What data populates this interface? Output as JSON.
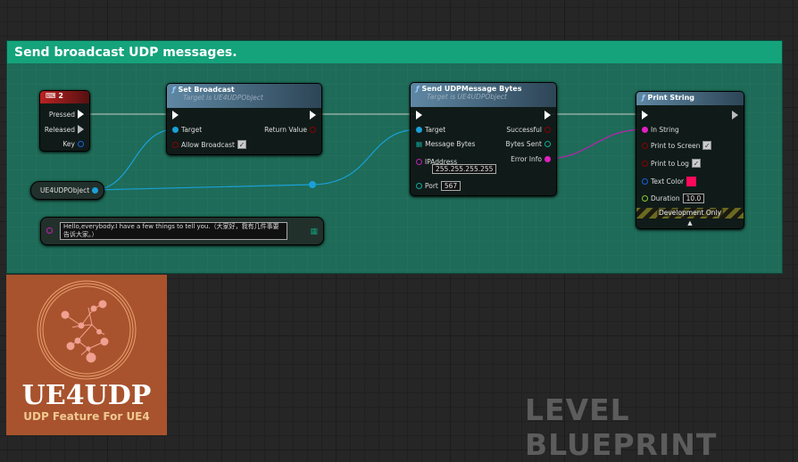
{
  "comment": {
    "title": "Send broadcast UDP messages."
  },
  "key_node": {
    "title": "2",
    "pins": [
      "Pressed",
      "Released",
      "Key"
    ]
  },
  "set_broadcast": {
    "title": "Set Broadcast",
    "subtitle": "Target is UE4UDPObject",
    "target": "Target",
    "allow": "Allow Broadcast",
    "return": "Return Value"
  },
  "object_var": {
    "label": "UE4UDPObject"
  },
  "string_node": {
    "value": "Hello,everybody.I have a few things to tell you.（大家好，我有几件事要告诉大家。）"
  },
  "send_udp": {
    "title": "Send UDPMessage Bytes",
    "subtitle": "Target is UE4UDPObject",
    "target": "Target",
    "message": "Message Bytes",
    "ip_label": "IPAddress",
    "ip": "255.255.255.255",
    "port_label": "Port",
    "port": "567",
    "successful": "Successful",
    "bytes_sent": "Bytes Sent",
    "error": "Error Info"
  },
  "print_string": {
    "title": "Print String",
    "in_string": "In String",
    "to_screen": "Print to Screen",
    "to_log": "Print to Log",
    "text_color": "Text Color",
    "color": "#ff0a5a",
    "duration_label": "Duration",
    "duration": "10.0",
    "dev": "Development Only"
  },
  "logo": {
    "title": "UE4UDP",
    "subtitle": "UDP Feature For UE4"
  },
  "watermark": "LEVEL BLUEPRINT"
}
